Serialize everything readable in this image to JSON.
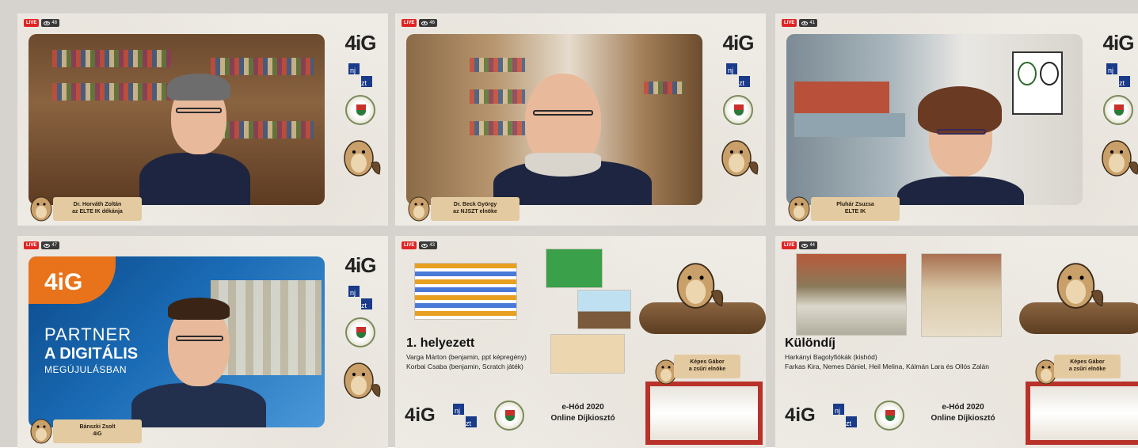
{
  "panels": [
    {
      "views": "48",
      "name_line1": "Dr. Horváth Zoltán",
      "name_line2": "az ELTE IK dékánja"
    },
    {
      "views": "46",
      "name_line1": "Dr. Beck György",
      "name_line2": "az NJSZT elnöke"
    },
    {
      "views": "41",
      "name_line1": "Pluhár Zsuzsa",
      "name_line2": "ELTE IK"
    },
    {
      "views": "47",
      "name_line1": "Bánszki Zsolt",
      "name_line2": "4iG",
      "promo_brand": "4iG",
      "promo_l1": "PARTNER",
      "promo_l2": "A DIGITÁLIS",
      "promo_l3": "MEGÚJULÁSBAN"
    },
    {
      "views": "43",
      "title": "1. helyezett",
      "line1": "Varga Márton (benjamin, ppt képregény)",
      "line2": "Korbai Csaba (benjamin, Scratch játék)",
      "jury_l1": "Képes Gábor",
      "jury_l2": "a zsűri elnöke",
      "event_l1": "e-Hód 2020",
      "event_l2": "Online Díjkiosztó"
    },
    {
      "views": "44",
      "title": "Különdíj",
      "line1": "Harkányi Bagolyfiókák (kishód)",
      "line2": "Farkas Kira, Nemes Dániel, Heil Melina, Kálmán Lara és Ollós Zalán",
      "jury_l1": "Képes Gábor",
      "jury_l2": "a zsűri elnöke",
      "event_l1": "e-Hód 2020",
      "event_l2": "Online Díjkiosztó"
    }
  ],
  "labels": {
    "live": "LIVE",
    "logo_4g": "4iG",
    "njszt": "nj sz t"
  },
  "colors": {
    "live": "#e02424",
    "nameplate": "#e4caa0",
    "frame": "#b8322a"
  }
}
